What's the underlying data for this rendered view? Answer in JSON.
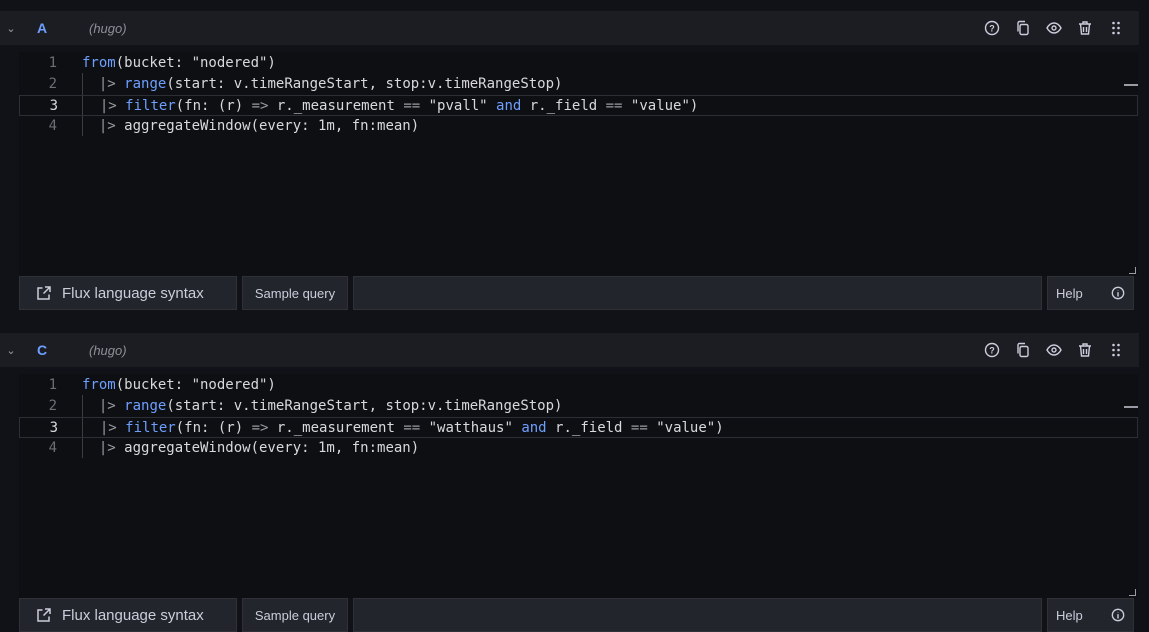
{
  "queries": [
    {
      "ref_id": "A",
      "datasource": "(hugo)",
      "lines": [
        {
          "num": "1",
          "parts": [
            [
              "kw",
              "from"
            ],
            [
              "t",
              "(bucket: \"nodered\")"
            ]
          ]
        },
        {
          "num": "2",
          "parts": [
            [
              "t",
              "  "
            ],
            [
              "op",
              "|>"
            ],
            [
              "t",
              " "
            ],
            [
              "kw",
              "range"
            ],
            [
              "t",
              "(start: v.timeRangeStart, stop:v.timeRangeStop)"
            ]
          ]
        },
        {
          "num": "3",
          "parts": [
            [
              "t",
              "  "
            ],
            [
              "op",
              "|>"
            ],
            [
              "t",
              " "
            ],
            [
              "kw",
              "filter"
            ],
            [
              "t",
              "(fn: (r) "
            ],
            [
              "op",
              "=>"
            ],
            [
              "t",
              " r._measurement "
            ],
            [
              "op",
              "=="
            ],
            [
              "t",
              " \"pvall\" "
            ],
            [
              "kw",
              "and"
            ],
            [
              "t",
              " r._field "
            ],
            [
              "op",
              "=="
            ],
            [
              "t",
              " \"value\")"
            ]
          ]
        },
        {
          "num": "4",
          "parts": [
            [
              "t",
              "  "
            ],
            [
              "op",
              "|>"
            ],
            [
              "t",
              " aggregateWindow(every: 1m, fn:mean)"
            ]
          ]
        }
      ]
    },
    {
      "ref_id": "C",
      "datasource": "(hugo)",
      "lines": [
        {
          "num": "1",
          "parts": [
            [
              "kw",
              "from"
            ],
            [
              "t",
              "(bucket: \"nodered\")"
            ]
          ]
        },
        {
          "num": "2",
          "parts": [
            [
              "t",
              "  "
            ],
            [
              "op",
              "|>"
            ],
            [
              "t",
              " "
            ],
            [
              "kw",
              "range"
            ],
            [
              "t",
              "(start: v.timeRangeStart, stop:v.timeRangeStop)"
            ]
          ]
        },
        {
          "num": "3",
          "parts": [
            [
              "t",
              "  "
            ],
            [
              "op",
              "|>"
            ],
            [
              "t",
              " "
            ],
            [
              "kw",
              "filter"
            ],
            [
              "t",
              "(fn: (r) "
            ],
            [
              "op",
              "=>"
            ],
            [
              "t",
              " r._measurement "
            ],
            [
              "op",
              "=="
            ],
            [
              "t",
              " \"watthaus\" "
            ],
            [
              "kw",
              "and"
            ],
            [
              "t",
              " r._field "
            ],
            [
              "op",
              "=="
            ],
            [
              "t",
              " \"value\")"
            ]
          ]
        },
        {
          "num": "4",
          "parts": [
            [
              "t",
              "  "
            ],
            [
              "op",
              "|>"
            ],
            [
              "t",
              " aggregateWindow(every: 1m, fn:mean)"
            ]
          ]
        }
      ]
    }
  ],
  "toolbar": {
    "flux_syntax_label": "Flux language syntax",
    "sample_query_label": "Sample query",
    "help_label": "Help"
  },
  "icons": {
    "collapse": "chevron-down-icon",
    "header_actions": [
      "question-circle-icon",
      "copy-icon",
      "eye-icon",
      "trash-icon",
      "drag-handle-icon"
    ],
    "external_link": "external-link-icon",
    "info": "info-circle-icon"
  },
  "colors": {
    "keyword": "#6e9fff",
    "ref_id": "#6e9fff",
    "background": "#111217",
    "editor_bg": "#0e0f13"
  }
}
